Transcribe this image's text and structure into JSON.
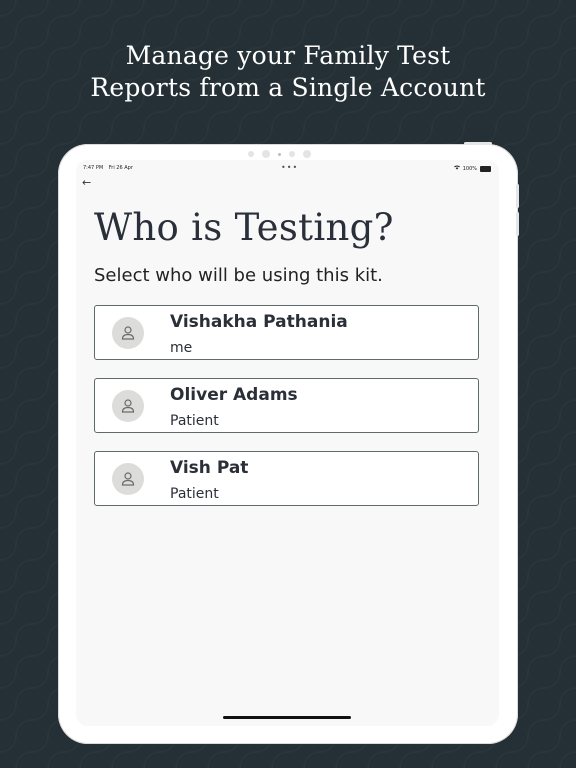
{
  "headline": {
    "line1": "Manage your Family Test",
    "line2": "Reports from a Single Account"
  },
  "status_bar": {
    "time": "7:47 PM",
    "date": "Fri 26 Apr",
    "center_dots": "•••",
    "battery": "100%"
  },
  "screen": {
    "title": "Who is Testing?",
    "subtitle": "Select who will be using this kit.",
    "members": [
      {
        "name": "Vishakha Pathania",
        "role": "me",
        "icon": "person-icon"
      },
      {
        "name": "Oliver Adams",
        "role": "Patient",
        "icon": "person-icon"
      },
      {
        "name": "Vish Pat",
        "role": "Patient",
        "icon": "person-icon"
      }
    ]
  },
  "icons": {
    "back": "arrow-left-icon",
    "wifi": "wifi-icon",
    "battery": "battery-icon"
  },
  "colors": {
    "background": "#243035",
    "card_border": "#5e6b68",
    "avatar_bg": "#dcdcda",
    "text_dark": "#2b2f38"
  }
}
